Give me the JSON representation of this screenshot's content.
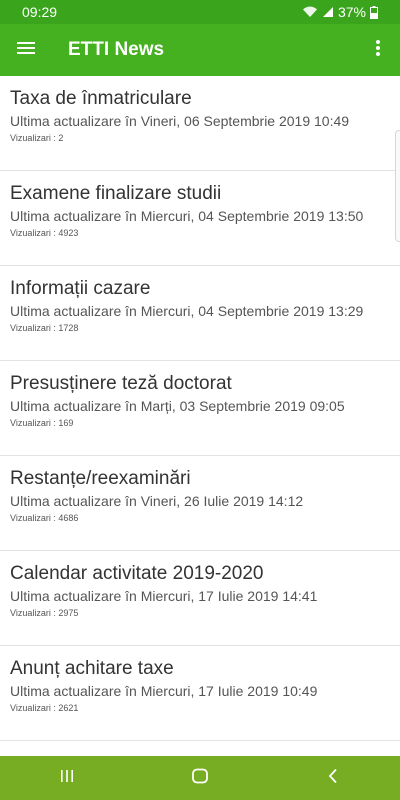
{
  "status_bar": {
    "time": "09:29",
    "battery": "37%"
  },
  "app_bar": {
    "title": "ETTI News"
  },
  "news": [
    {
      "title": "Taxa de înmatriculare",
      "updated": "Ultima actualizare în Vineri, 06 Septembrie 2019 10:49",
      "views": "Vizualizari : 2"
    },
    {
      "title": "Examene finalizare studii",
      "updated": "Ultima actualizare în Miercuri, 04 Septembrie 2019 13:50",
      "views": "Vizualizari : 4923"
    },
    {
      "title": "Informații cazare",
      "updated": "Ultima actualizare în Miercuri, 04 Septembrie 2019 13:29",
      "views": "Vizualizari : 1728"
    },
    {
      "title": "Presusținere teză doctorat",
      "updated": "Ultima actualizare în Marți, 03 Septembrie 2019 09:05",
      "views": "Vizualizari : 169"
    },
    {
      "title": "Restanțe/reexaminări",
      "updated": "Ultima actualizare în Vineri, 26 Iulie 2019 14:12",
      "views": "Vizualizari : 4686"
    },
    {
      "title": "Calendar activitate 2019-2020",
      "updated": "Ultima actualizare în Miercuri, 17 Iulie 2019 14:41",
      "views": "Vizualizari : 2975"
    },
    {
      "title": "Anunț achitare taxe",
      "updated": "Ultima actualizare în Miercuri, 17 Iulie 2019 10:49",
      "views": "Vizualizari : 2621"
    }
  ],
  "icons": {
    "menu": "hamburger-menu-icon",
    "more": "more-vert-icon",
    "wifi": "wifi-icon",
    "signal": "signal-icon",
    "battery": "battery-icon",
    "nav_recents": "recents-icon",
    "nav_home": "home-icon",
    "nav_back": "back-icon"
  },
  "colors": {
    "status_bar": "#3aa51c",
    "app_bar": "#45b020",
    "nav_bar": "#76ad22"
  }
}
